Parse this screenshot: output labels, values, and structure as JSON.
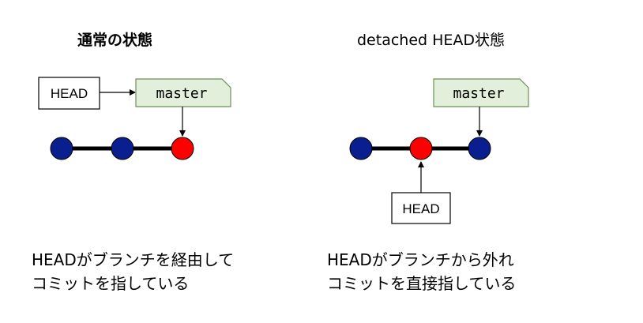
{
  "left_panel": {
    "title": "通常の状態",
    "head_label": "HEAD",
    "branch_label": "master",
    "caption_line1": "HEADがブランチを経由して",
    "caption_line2": "コミットを指している"
  },
  "right_panel": {
    "title": "detached HEAD状態",
    "head_label": "HEAD",
    "branch_label": "master",
    "caption_line1": "HEADがブランチから外れ",
    "caption_line2": "コミットを直接指している"
  },
  "colors": {
    "commit": "#0a1f8f",
    "head_commit": "#ff0000",
    "branch_fill": "#e2efda",
    "branch_stroke": "#6d8f5a",
    "line": "#000000"
  }
}
